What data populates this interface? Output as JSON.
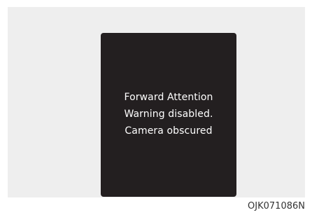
{
  "display": {
    "message_lines": [
      "Forward Attention",
      "Warning disabled.",
      "Camera obscured"
    ]
  },
  "figure": {
    "code": "OJK071086N"
  },
  "colors": {
    "page_background": "#ffffff",
    "figure_background": "#eeeeee",
    "display_background": "#231f20",
    "display_text": "#ffffff"
  }
}
